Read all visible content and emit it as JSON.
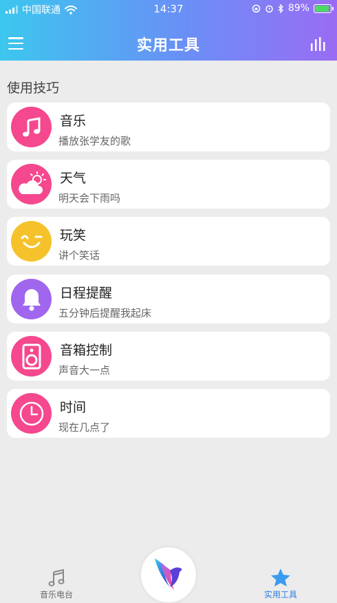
{
  "status_bar": {
    "carrier": "中国联通",
    "time": "14:37",
    "battery": "89%"
  },
  "header": {
    "title": "实用工具"
  },
  "section": {
    "title": "使用技巧"
  },
  "tools": [
    {
      "title": "音乐",
      "subtitle": "播放张学友的歌",
      "icon": "music-note-icon",
      "color": "#f5488e"
    },
    {
      "title": "天气",
      "subtitle": "明天会下雨吗",
      "icon": "weather-icon",
      "color": "#f5488e"
    },
    {
      "title": "玩笑",
      "subtitle": "讲个笑话",
      "icon": "wink-face-icon",
      "color": "#f5c22c"
    },
    {
      "title": "日程提醒",
      "subtitle": "五分钟后提醒我起床",
      "icon": "bell-icon",
      "color": "#a067ee"
    },
    {
      "title": "音箱控制",
      "subtitle": "声音大一点",
      "icon": "speaker-icon",
      "color": "#f5488e"
    },
    {
      "title": "时间",
      "subtitle": "现在几点了",
      "icon": "clock-icon",
      "color": "#f5488e"
    }
  ],
  "tabbar": {
    "music_radio": "音乐电台",
    "tools": "实用工具"
  },
  "colors": {
    "header_gradient_start": "#3cc7ee",
    "header_gradient_end": "#9a6cf3",
    "active_tab": "#2b7de3"
  }
}
